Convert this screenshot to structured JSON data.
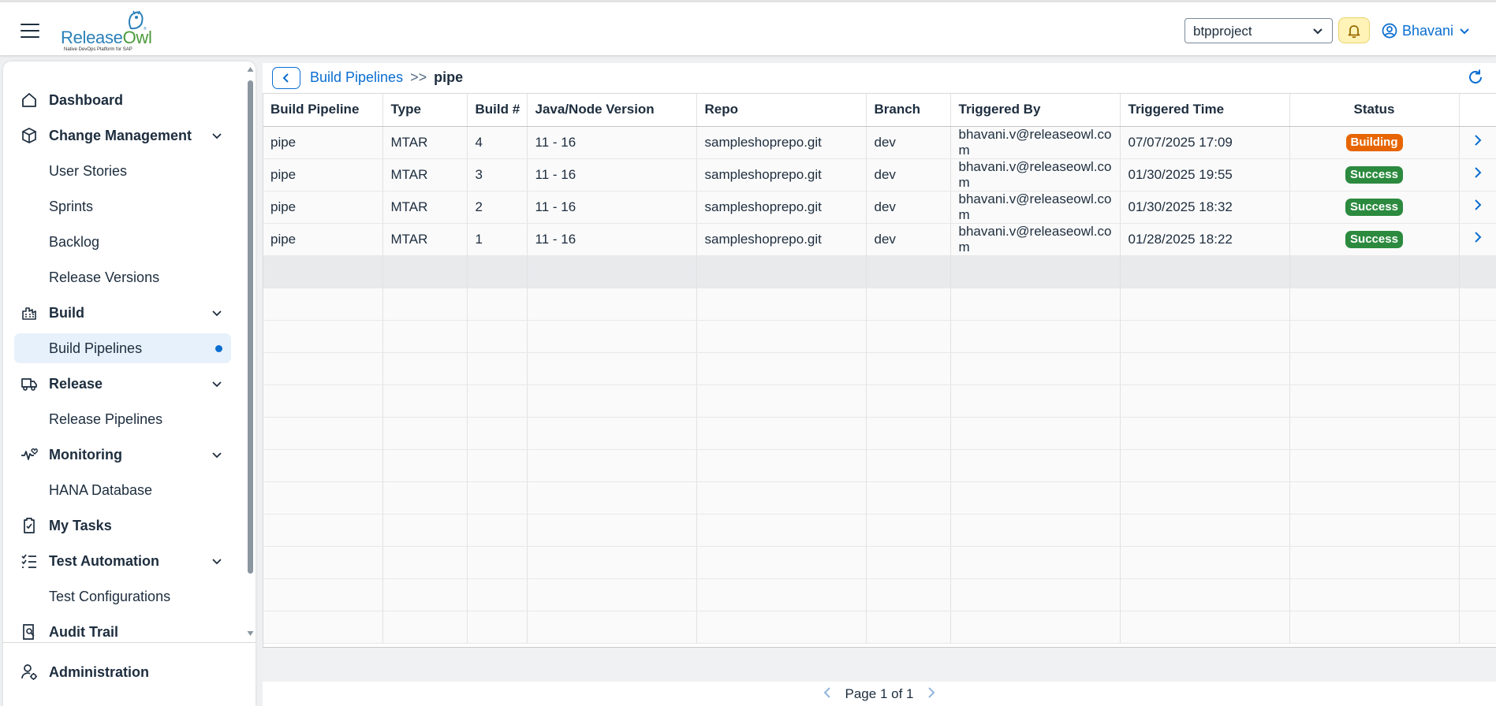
{
  "app": {
    "logo_text_a": "Release",
    "logo_text_b": "Owl",
    "logo_tagline": "Native DevOps Platform for SAP"
  },
  "header": {
    "project": "btpproject",
    "user": "Bhavani"
  },
  "sidebar": {
    "items": [
      {
        "label": "Dashboard"
      },
      {
        "label": "Change Management"
      },
      {
        "label": "User Stories"
      },
      {
        "label": "Sprints"
      },
      {
        "label": "Backlog"
      },
      {
        "label": "Release Versions"
      },
      {
        "label": "Build"
      },
      {
        "label": "Build Pipelines"
      },
      {
        "label": "Release"
      },
      {
        "label": "Release Pipelines"
      },
      {
        "label": "Monitoring"
      },
      {
        "label": "HANA Database"
      },
      {
        "label": "My Tasks"
      },
      {
        "label": "Test Automation"
      },
      {
        "label": "Test Configurations"
      },
      {
        "label": "Audit Trail"
      }
    ],
    "admin": "Administration"
  },
  "breadcrumb": {
    "parent": "Build Pipelines",
    "separator": ">>",
    "current": "pipe"
  },
  "table": {
    "columns": [
      "Build Pipeline",
      "Type",
      "Build #",
      "Java/Node Version",
      "Repo",
      "Branch",
      "Triggered By",
      "Triggered Time",
      "Status"
    ],
    "rows": [
      {
        "pipeline": "pipe",
        "type": "MTAR",
        "build": "4",
        "version": "11 - 16",
        "repo": "sampleshoprepo.git",
        "branch": "dev",
        "triggered_by": "bhavani.v@releaseowl.com",
        "time": "07/07/2025 17:09",
        "status": "Building"
      },
      {
        "pipeline": "pipe",
        "type": "MTAR",
        "build": "3",
        "version": "11 - 16",
        "repo": "sampleshoprepo.git",
        "branch": "dev",
        "triggered_by": "bhavani.v@releaseowl.com",
        "time": "01/30/2025 19:55",
        "status": "Success"
      },
      {
        "pipeline": "pipe",
        "type": "MTAR",
        "build": "2",
        "version": "11 - 16",
        "repo": "sampleshoprepo.git",
        "branch": "dev",
        "triggered_by": "bhavani.v@releaseowl.com",
        "time": "01/30/2025 18:32",
        "status": "Success"
      },
      {
        "pipeline": "pipe",
        "type": "MTAR",
        "build": "1",
        "version": "11 - 16",
        "repo": "sampleshoprepo.git",
        "branch": "dev",
        "triggered_by": "bhavani.v@releaseowl.com",
        "time": "01/28/2025 18:22",
        "status": "Success"
      }
    ]
  },
  "pager": {
    "text": "Page 1 of 1"
  },
  "colors": {
    "accent": "#0a6ed1",
    "building": "#e76500",
    "success": "#2b8a3e",
    "bell_bg": "#fff3b8"
  },
  "icons": [
    "menu-icon",
    "bell-icon",
    "user-circle-icon",
    "chevron-down-icon",
    "home-icon",
    "cube-icon",
    "factory-icon",
    "truck-icon",
    "heart-pulse-icon",
    "clipboard-icon",
    "checklist-icon",
    "audit-icon",
    "user-settings-icon",
    "back-icon",
    "refresh-icon",
    "chevron-right-icon"
  ]
}
